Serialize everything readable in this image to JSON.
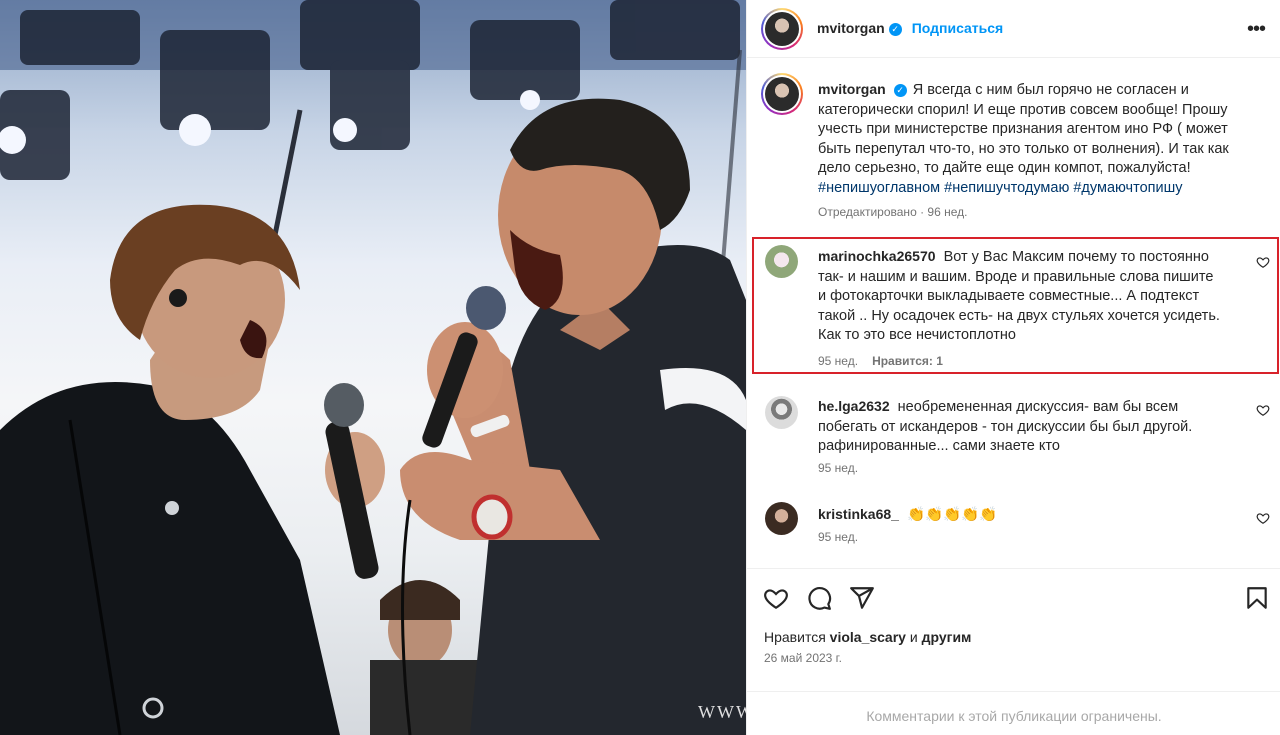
{
  "photo": {
    "alt_icon": "concert-photo",
    "watermark": "WWW"
  },
  "header": {
    "username": "mvitorgan",
    "follow_label": "Подписаться",
    "more_icon": "more-icon",
    "verified_icon": "verified-badge-icon"
  },
  "caption": {
    "username": "mvitorgan",
    "text": "Я всегда с ним был горячо не согласен и категорически спорил! И еще против совсем вообще! Прошу учесть при министерстве признания агентом ино РФ ( может быть перепутал что-то, но это только от волнения). И так как дело серьезно, то дайте еще один компот, пожалуйста!",
    "hashtags": "#непишуоглавном #непишучтодумаю #думаючтопишу",
    "meta": "Отредактировано · 96 нед."
  },
  "comments": [
    {
      "username": "marinochka26570",
      "text": "Вот у Вас Максим почему то постоянно так- и нашим и вашим. Вроде и правильные слова пишите и фотокарточки выкладываете совместные... А подтекст такой .. Ну осадочек есть- на двух стульях хочется усидеть. Как то это все нечистоплотно",
      "age": "95 нед.",
      "likes": "Нравится: 1",
      "highlighted": true
    },
    {
      "username": "he.lga2632",
      "text": "необремененная дискуссия- вам бы всем побегать от искандеров - тон дискуссии бы был другой. рафинированные... сами знаете кто",
      "age": "95 нед.",
      "likes": ""
    },
    {
      "username": "kristinka68_",
      "text": "👏👏👏👏👏",
      "age": "95 нед.",
      "likes": ""
    }
  ],
  "actions": {
    "like_icon": "heart-icon",
    "comment_icon": "comment-icon",
    "share_icon": "share-icon",
    "save_icon": "bookmark-icon",
    "likes_prefix": "Нравится",
    "likes_user": "viola_scary",
    "likes_and": "и",
    "likes_others": "другим",
    "date": "26 май 2023 г.",
    "restricted": "Комментарии к этой публикации ограничены."
  },
  "colors": {
    "accent": "#0095f6",
    "highlight_border": "#d8222a",
    "secondary_text": "#737373",
    "hashtag": "#00376b"
  }
}
